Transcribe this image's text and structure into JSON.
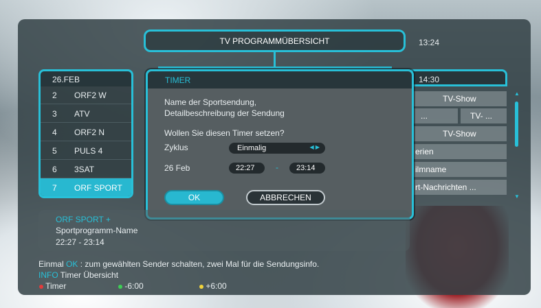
{
  "clock": "13:24",
  "title": "TV PROGRAMMÜBERSICHT",
  "date_header": "26.FEB",
  "time_header": "14:30",
  "channels": [
    {
      "num": "2",
      "name": "ORF2 W"
    },
    {
      "num": "3",
      "name": "ATV"
    },
    {
      "num": "4",
      "name": "ORF2 N"
    },
    {
      "num": "5",
      "name": "PULS 4"
    },
    {
      "num": "6",
      "name": "3SAT"
    },
    {
      "num": "7",
      "name": "ORF SPORT"
    }
  ],
  "programs": [
    "TV-Show",
    "...",
    "TV- ...",
    "TV-Show",
    "erien",
    "ilmname",
    "rt-Nachrichten ..."
  ],
  "dialog": {
    "header": "TIMER",
    "desc_line1": "Name der Sportsendung,",
    "desc_line2": "Detailbeschreibung der Sendung",
    "question": "Wollen Sie diesen Timer setzen?",
    "cycle_label": "Zyklus",
    "cycle_value": "Einmalig",
    "date_label": "26 Feb",
    "start_time": "22:27",
    "dash": "-",
    "end_time": "23:14",
    "ok_label": "OK",
    "cancel_label": "ABBRECHEN"
  },
  "info": {
    "channel": "ORF SPORT +",
    "program": "Sportprogramm-Name",
    "time": "22:27 - 23:14"
  },
  "footer": {
    "line1_pre": "Einmal",
    "line1_key": "OK",
    "line1_post": ": zum gewählten Sender schalten, zwei Mal für die Sendungsinfo.",
    "line2_key": "INFO",
    "line2_post": "Timer Übersicht",
    "red_label": "Timer",
    "green_label": "-6:00",
    "yellow_label": "+6:00"
  },
  "colors": {
    "accent": "#28c0d8",
    "red": "#e23b3b",
    "green": "#3ecf55",
    "yellow": "#f2d43b"
  }
}
